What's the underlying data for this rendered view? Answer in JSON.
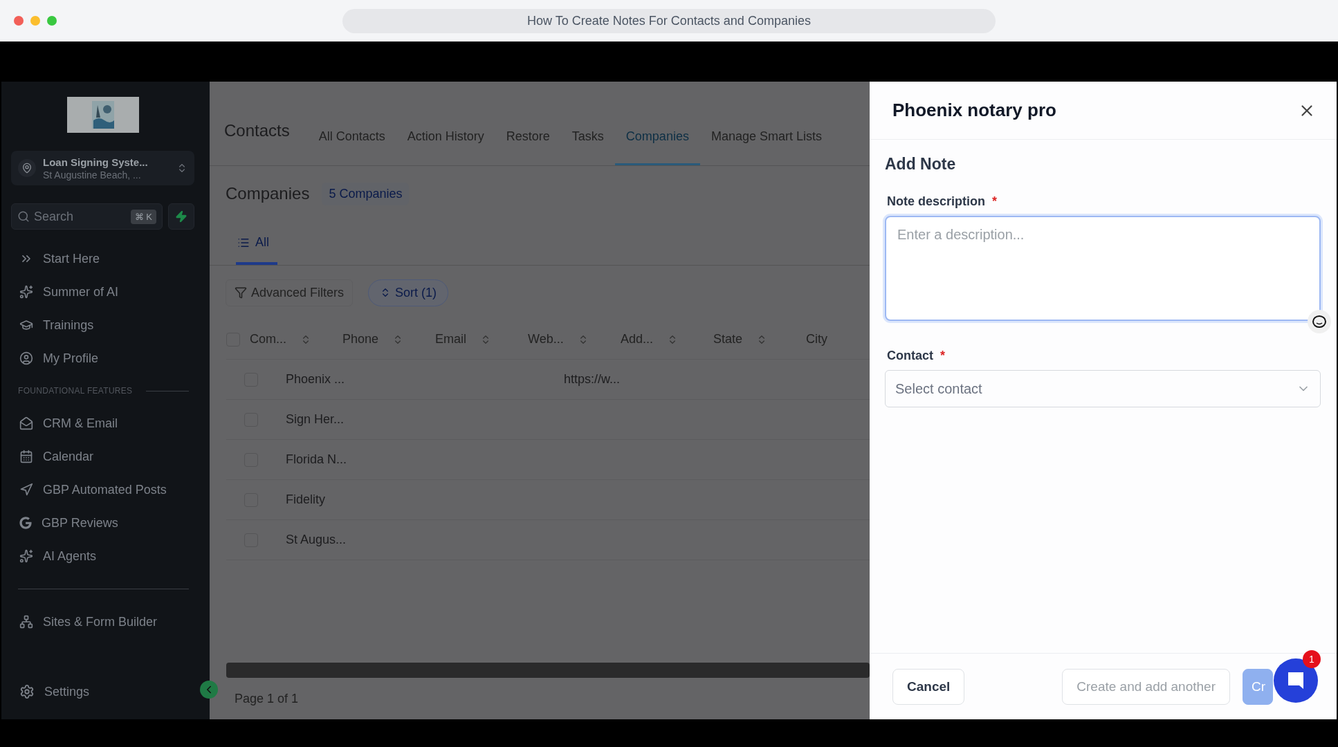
{
  "browser": {
    "title": "How To Create Notes For Contacts and Companies"
  },
  "sidebar": {
    "account": {
      "name": "Loan Signing Syste...",
      "location": "St Augustine Beach, ..."
    },
    "search": {
      "placeholder": "Search",
      "shortcut": "⌘ K"
    },
    "items": [
      {
        "kind": "item",
        "label": "Start Here"
      },
      {
        "kind": "item",
        "label": "Summer of AI"
      },
      {
        "kind": "item",
        "label": "Trainings"
      },
      {
        "kind": "item",
        "label": "My Profile"
      },
      {
        "kind": "section",
        "label": "FOUNDATIONAL FEATURES"
      },
      {
        "kind": "item",
        "label": "CRM & Email"
      },
      {
        "kind": "item",
        "label": "Calendar"
      },
      {
        "kind": "item",
        "label": "GBP Automated Posts"
      },
      {
        "kind": "item",
        "label": "GBP Reviews"
      },
      {
        "kind": "item",
        "label": "AI Agents"
      },
      {
        "kind": "divider"
      },
      {
        "kind": "item",
        "label": "Sites & Form Builder"
      }
    ],
    "settings": "Settings"
  },
  "main": {
    "title": "Contacts",
    "tabs": [
      {
        "label": "All Contacts",
        "selected": false
      },
      {
        "label": "Action History",
        "selected": false
      },
      {
        "label": "Restore",
        "selected": false
      },
      {
        "label": "Tasks",
        "selected": false
      },
      {
        "label": "Companies",
        "selected": true
      },
      {
        "label": "Manage Smart Lists",
        "selected": false
      }
    ],
    "heading": "Companies",
    "count": "5 Companies",
    "views": [
      {
        "label": "All",
        "selected": true
      }
    ],
    "filters": "Advanced Filters",
    "sort": "Sort (1)",
    "table": {
      "header_checked": false,
      "columns": [
        "Com...",
        "Phone",
        "Email",
        "Web...",
        "Add...",
        "State",
        "City"
      ],
      "rows": [
        {
          "checked": false,
          "company": "Phoenix ...",
          "website": "https://w..."
        },
        {
          "checked": false,
          "company": "Sign Her..."
        },
        {
          "checked": false,
          "company": "Florida N..."
        },
        {
          "checked": false,
          "company": "Fidelity"
        },
        {
          "checked": false,
          "company": "St Augus..."
        }
      ]
    },
    "pagination": "Page 1 of 1"
  },
  "panel": {
    "title": "Phoenix notary pro",
    "heading": "Add Note",
    "description": {
      "label": "Note description",
      "required": "*",
      "placeholder": "Enter a description..."
    },
    "contact": {
      "label": "Contact",
      "required": "*",
      "placeholder": "Select contact"
    },
    "buttons": {
      "cancel": "Cancel",
      "create_another": "Create and add another",
      "create": "Cr"
    },
    "chat_badge": "1"
  }
}
